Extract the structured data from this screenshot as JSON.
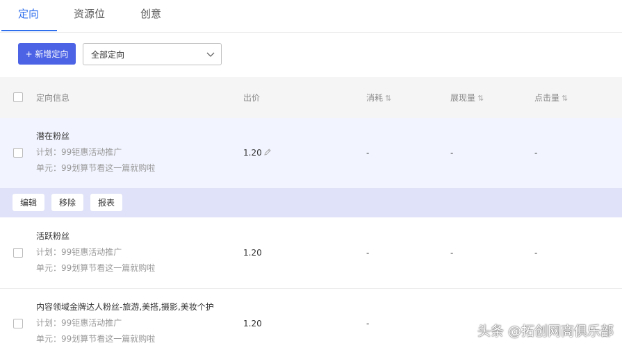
{
  "tabs": [
    {
      "label": "定向",
      "active": true
    },
    {
      "label": "资源位",
      "active": false
    },
    {
      "label": "创意",
      "active": false
    }
  ],
  "toolbar": {
    "add_label": "+ 新增定向",
    "filter_value": "全部定向"
  },
  "table": {
    "columns": [
      {
        "label": "定向信息",
        "sort": ""
      },
      {
        "label": "出价",
        "sort": ""
      },
      {
        "label": "消耗",
        "sort": "⇅"
      },
      {
        "label": "展现量",
        "sort": "⇅"
      },
      {
        "label": "点击量",
        "sort": "⇅"
      }
    ],
    "rows": [
      {
        "name": "潜在粉丝",
        "plan": "计划：99钜惠活动推广",
        "unit": "单元：99划算节看这一篇就购啦",
        "price": "1.20",
        "spend": "-",
        "impressions": "-",
        "clicks": "-"
      },
      {
        "name": "活跃粉丝",
        "plan": "计划：99钜惠活动推广",
        "unit": "单元：99划算节看这一篇就购啦",
        "price": "1.20",
        "spend": "-",
        "impressions": "-",
        "clicks": "-"
      },
      {
        "name": "内容领域金牌达人粉丝-旅游,美搭,摄影,美妆个护",
        "plan": "计划：99钜惠活动推广",
        "unit": "单元：99划算节看这一篇就购啦",
        "price": "1.20",
        "spend": "-",
        "impressions": "",
        "clicks": ""
      }
    ]
  },
  "row_actions": {
    "edit": "编辑",
    "remove": "移除",
    "report": "报表"
  },
  "watermark": "头条 @拓创网商俱乐部",
  "colors": {
    "accent": "#2f6fed",
    "primary_button": "#4c63e6",
    "selected_row": "#f2f4ff",
    "action_bar": "#dfe2f8"
  }
}
